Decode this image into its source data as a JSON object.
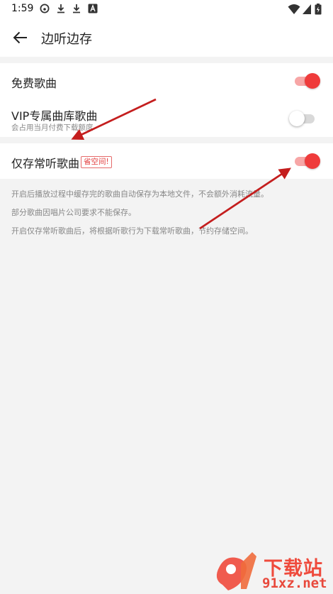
{
  "status_bar": {
    "time": "1:59",
    "left_icons": [
      "netease-music-icon",
      "download-icon",
      "download-icon",
      "a-notification-icon"
    ],
    "right_icons": [
      "wifi-icon",
      "signal-icon",
      "battery-icon"
    ]
  },
  "header": {
    "title": "边听边存",
    "back_icon": "back-arrow-icon"
  },
  "settings": {
    "free_songs": {
      "label": "免费歌曲",
      "enabled": true
    },
    "vip_songs": {
      "label": "VIP专属曲库歌曲",
      "sublabel": "会占用当月付费下载额度",
      "enabled": false
    },
    "frequent_songs": {
      "label": "仅存常听歌曲",
      "badge": "省空间!",
      "enabled": true
    }
  },
  "notes": [
    "开启后播放过程中缓存完的歌曲自动保存为本地文件，不会额外消耗流量。",
    "部分歌曲因唱片公司要求不能保存。",
    "开启仅存常听歌曲后，将根据听歌行为下载常听歌曲，节约存储空间。"
  ],
  "watermark": {
    "brand": "下载站",
    "url": "91xz.net"
  },
  "colors": {
    "accent": "#ef3b3b",
    "accent_light": "#f7a6a6",
    "annotation_arrow": "#c41e1e",
    "background": "#f3f3f3"
  }
}
